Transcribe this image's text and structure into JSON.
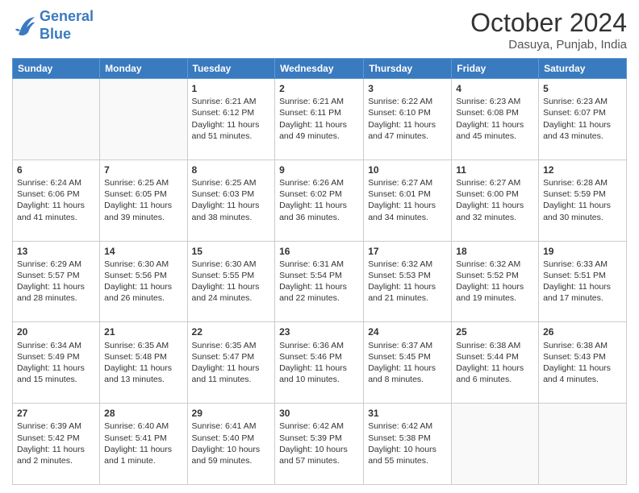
{
  "logo": {
    "line1": "General",
    "line2": "Blue"
  },
  "title": "October 2024",
  "subtitle": "Dasuya, Punjab, India",
  "days_of_week": [
    "Sunday",
    "Monday",
    "Tuesday",
    "Wednesday",
    "Thursday",
    "Friday",
    "Saturday"
  ],
  "weeks": [
    [
      {
        "day": "",
        "sunrise": "",
        "sunset": "",
        "daylight": ""
      },
      {
        "day": "",
        "sunrise": "",
        "sunset": "",
        "daylight": ""
      },
      {
        "day": "1",
        "sunrise": "Sunrise: 6:21 AM",
        "sunset": "Sunset: 6:12 PM",
        "daylight": "Daylight: 11 hours and 51 minutes."
      },
      {
        "day": "2",
        "sunrise": "Sunrise: 6:21 AM",
        "sunset": "Sunset: 6:11 PM",
        "daylight": "Daylight: 11 hours and 49 minutes."
      },
      {
        "day": "3",
        "sunrise": "Sunrise: 6:22 AM",
        "sunset": "Sunset: 6:10 PM",
        "daylight": "Daylight: 11 hours and 47 minutes."
      },
      {
        "day": "4",
        "sunrise": "Sunrise: 6:23 AM",
        "sunset": "Sunset: 6:08 PM",
        "daylight": "Daylight: 11 hours and 45 minutes."
      },
      {
        "day": "5",
        "sunrise": "Sunrise: 6:23 AM",
        "sunset": "Sunset: 6:07 PM",
        "daylight": "Daylight: 11 hours and 43 minutes."
      }
    ],
    [
      {
        "day": "6",
        "sunrise": "Sunrise: 6:24 AM",
        "sunset": "Sunset: 6:06 PM",
        "daylight": "Daylight: 11 hours and 41 minutes."
      },
      {
        "day": "7",
        "sunrise": "Sunrise: 6:25 AM",
        "sunset": "Sunset: 6:05 PM",
        "daylight": "Daylight: 11 hours and 39 minutes."
      },
      {
        "day": "8",
        "sunrise": "Sunrise: 6:25 AM",
        "sunset": "Sunset: 6:03 PM",
        "daylight": "Daylight: 11 hours and 38 minutes."
      },
      {
        "day": "9",
        "sunrise": "Sunrise: 6:26 AM",
        "sunset": "Sunset: 6:02 PM",
        "daylight": "Daylight: 11 hours and 36 minutes."
      },
      {
        "day": "10",
        "sunrise": "Sunrise: 6:27 AM",
        "sunset": "Sunset: 6:01 PM",
        "daylight": "Daylight: 11 hours and 34 minutes."
      },
      {
        "day": "11",
        "sunrise": "Sunrise: 6:27 AM",
        "sunset": "Sunset: 6:00 PM",
        "daylight": "Daylight: 11 hours and 32 minutes."
      },
      {
        "day": "12",
        "sunrise": "Sunrise: 6:28 AM",
        "sunset": "Sunset: 5:59 PM",
        "daylight": "Daylight: 11 hours and 30 minutes."
      }
    ],
    [
      {
        "day": "13",
        "sunrise": "Sunrise: 6:29 AM",
        "sunset": "Sunset: 5:57 PM",
        "daylight": "Daylight: 11 hours and 28 minutes."
      },
      {
        "day": "14",
        "sunrise": "Sunrise: 6:30 AM",
        "sunset": "Sunset: 5:56 PM",
        "daylight": "Daylight: 11 hours and 26 minutes."
      },
      {
        "day": "15",
        "sunrise": "Sunrise: 6:30 AM",
        "sunset": "Sunset: 5:55 PM",
        "daylight": "Daylight: 11 hours and 24 minutes."
      },
      {
        "day": "16",
        "sunrise": "Sunrise: 6:31 AM",
        "sunset": "Sunset: 5:54 PM",
        "daylight": "Daylight: 11 hours and 22 minutes."
      },
      {
        "day": "17",
        "sunrise": "Sunrise: 6:32 AM",
        "sunset": "Sunset: 5:53 PM",
        "daylight": "Daylight: 11 hours and 21 minutes."
      },
      {
        "day": "18",
        "sunrise": "Sunrise: 6:32 AM",
        "sunset": "Sunset: 5:52 PM",
        "daylight": "Daylight: 11 hours and 19 minutes."
      },
      {
        "day": "19",
        "sunrise": "Sunrise: 6:33 AM",
        "sunset": "Sunset: 5:51 PM",
        "daylight": "Daylight: 11 hours and 17 minutes."
      }
    ],
    [
      {
        "day": "20",
        "sunrise": "Sunrise: 6:34 AM",
        "sunset": "Sunset: 5:49 PM",
        "daylight": "Daylight: 11 hours and 15 minutes."
      },
      {
        "day": "21",
        "sunrise": "Sunrise: 6:35 AM",
        "sunset": "Sunset: 5:48 PM",
        "daylight": "Daylight: 11 hours and 13 minutes."
      },
      {
        "day": "22",
        "sunrise": "Sunrise: 6:35 AM",
        "sunset": "Sunset: 5:47 PM",
        "daylight": "Daylight: 11 hours and 11 minutes."
      },
      {
        "day": "23",
        "sunrise": "Sunrise: 6:36 AM",
        "sunset": "Sunset: 5:46 PM",
        "daylight": "Daylight: 11 hours and 10 minutes."
      },
      {
        "day": "24",
        "sunrise": "Sunrise: 6:37 AM",
        "sunset": "Sunset: 5:45 PM",
        "daylight": "Daylight: 11 hours and 8 minutes."
      },
      {
        "day": "25",
        "sunrise": "Sunrise: 6:38 AM",
        "sunset": "Sunset: 5:44 PM",
        "daylight": "Daylight: 11 hours and 6 minutes."
      },
      {
        "day": "26",
        "sunrise": "Sunrise: 6:38 AM",
        "sunset": "Sunset: 5:43 PM",
        "daylight": "Daylight: 11 hours and 4 minutes."
      }
    ],
    [
      {
        "day": "27",
        "sunrise": "Sunrise: 6:39 AM",
        "sunset": "Sunset: 5:42 PM",
        "daylight": "Daylight: 11 hours and 2 minutes."
      },
      {
        "day": "28",
        "sunrise": "Sunrise: 6:40 AM",
        "sunset": "Sunset: 5:41 PM",
        "daylight": "Daylight: 11 hours and 1 minute."
      },
      {
        "day": "29",
        "sunrise": "Sunrise: 6:41 AM",
        "sunset": "Sunset: 5:40 PM",
        "daylight": "Daylight: 10 hours and 59 minutes."
      },
      {
        "day": "30",
        "sunrise": "Sunrise: 6:42 AM",
        "sunset": "Sunset: 5:39 PM",
        "daylight": "Daylight: 10 hours and 57 minutes."
      },
      {
        "day": "31",
        "sunrise": "Sunrise: 6:42 AM",
        "sunset": "Sunset: 5:38 PM",
        "daylight": "Daylight: 10 hours and 55 minutes."
      },
      {
        "day": "",
        "sunrise": "",
        "sunset": "",
        "daylight": ""
      },
      {
        "day": "",
        "sunrise": "",
        "sunset": "",
        "daylight": ""
      }
    ]
  ]
}
